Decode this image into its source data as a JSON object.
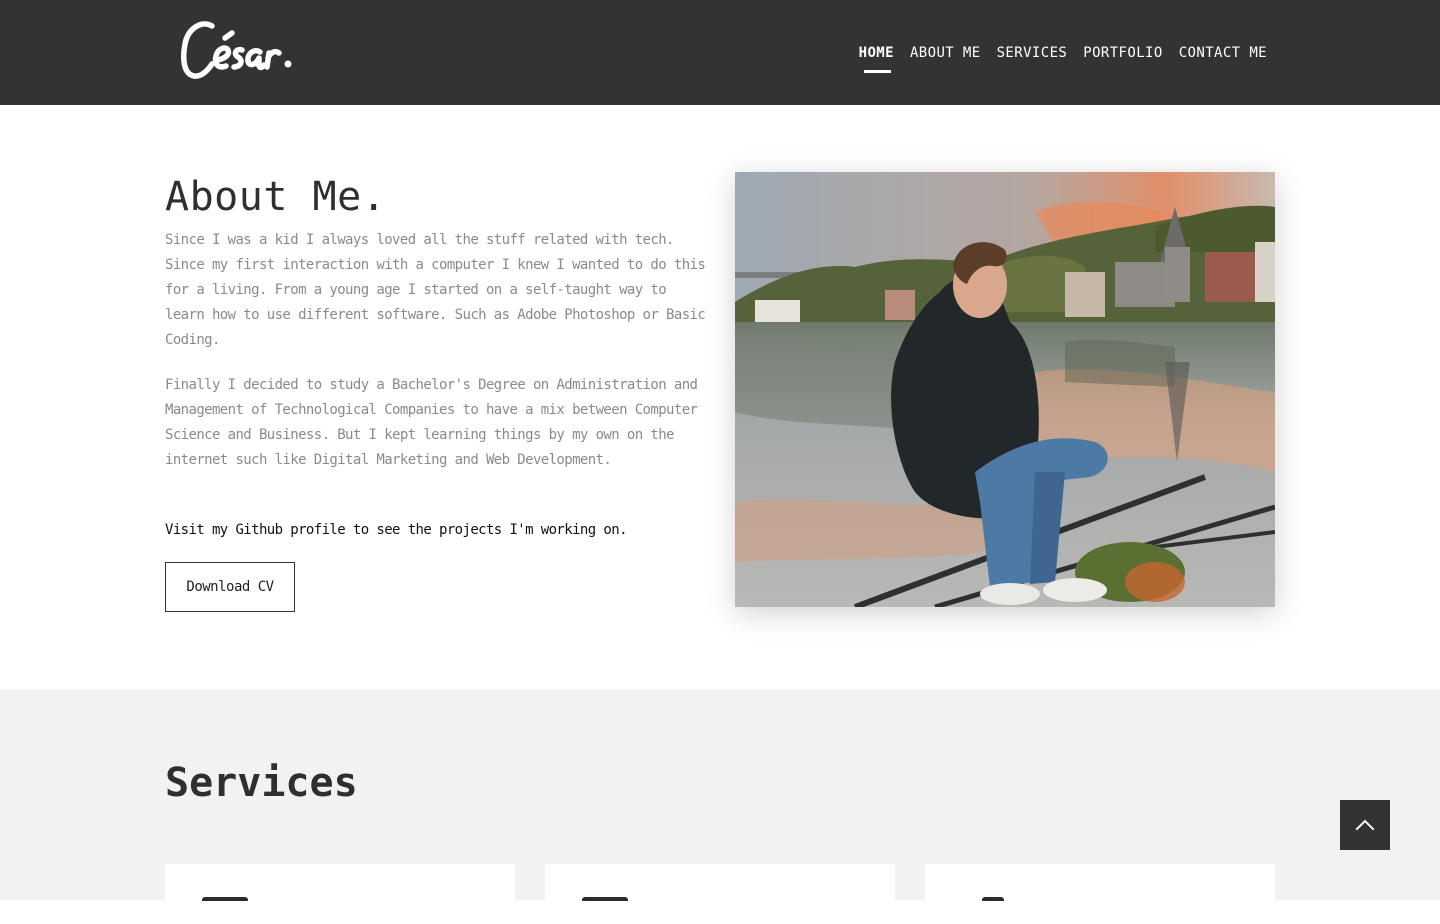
{
  "header": {
    "logo_text": "César.",
    "nav": [
      {
        "label": "HOME",
        "active": true
      },
      {
        "label": "ABOUT ME",
        "active": false
      },
      {
        "label": "SERVICES",
        "active": false
      },
      {
        "label": "PORTFOLIO",
        "active": false
      },
      {
        "label": "CONTACT ME",
        "active": false
      }
    ]
  },
  "about": {
    "title": "About Me.",
    "paragraphs": [
      "Since I was a kid I always loved all the stuff related with tech. Since my first interaction with a computer I knew I wanted to do this for a living. From a young age I started on a self-taught way to learn how to use different software. Such as Adobe Photoshop or Basic Coding.",
      "Finally I decided to study a Bachelor's Degree on Administration and Management of Technological Companies to have a mix between Computer Science and Business. But I kept learning things by my own on the internet such like Digital Marketing and Web Development.",
      "Visit my Github profile to see the projects I'm working on."
    ],
    "cv_button": "Download CV"
  },
  "services": {
    "title": "Services"
  },
  "scroll_top": {
    "icon": "chevron-up-icon"
  },
  "colors": {
    "header_bg": "#333333",
    "services_bg": "#f1f2f4",
    "body_text": "#8a8a8a",
    "heading": "#2f2f2f"
  }
}
